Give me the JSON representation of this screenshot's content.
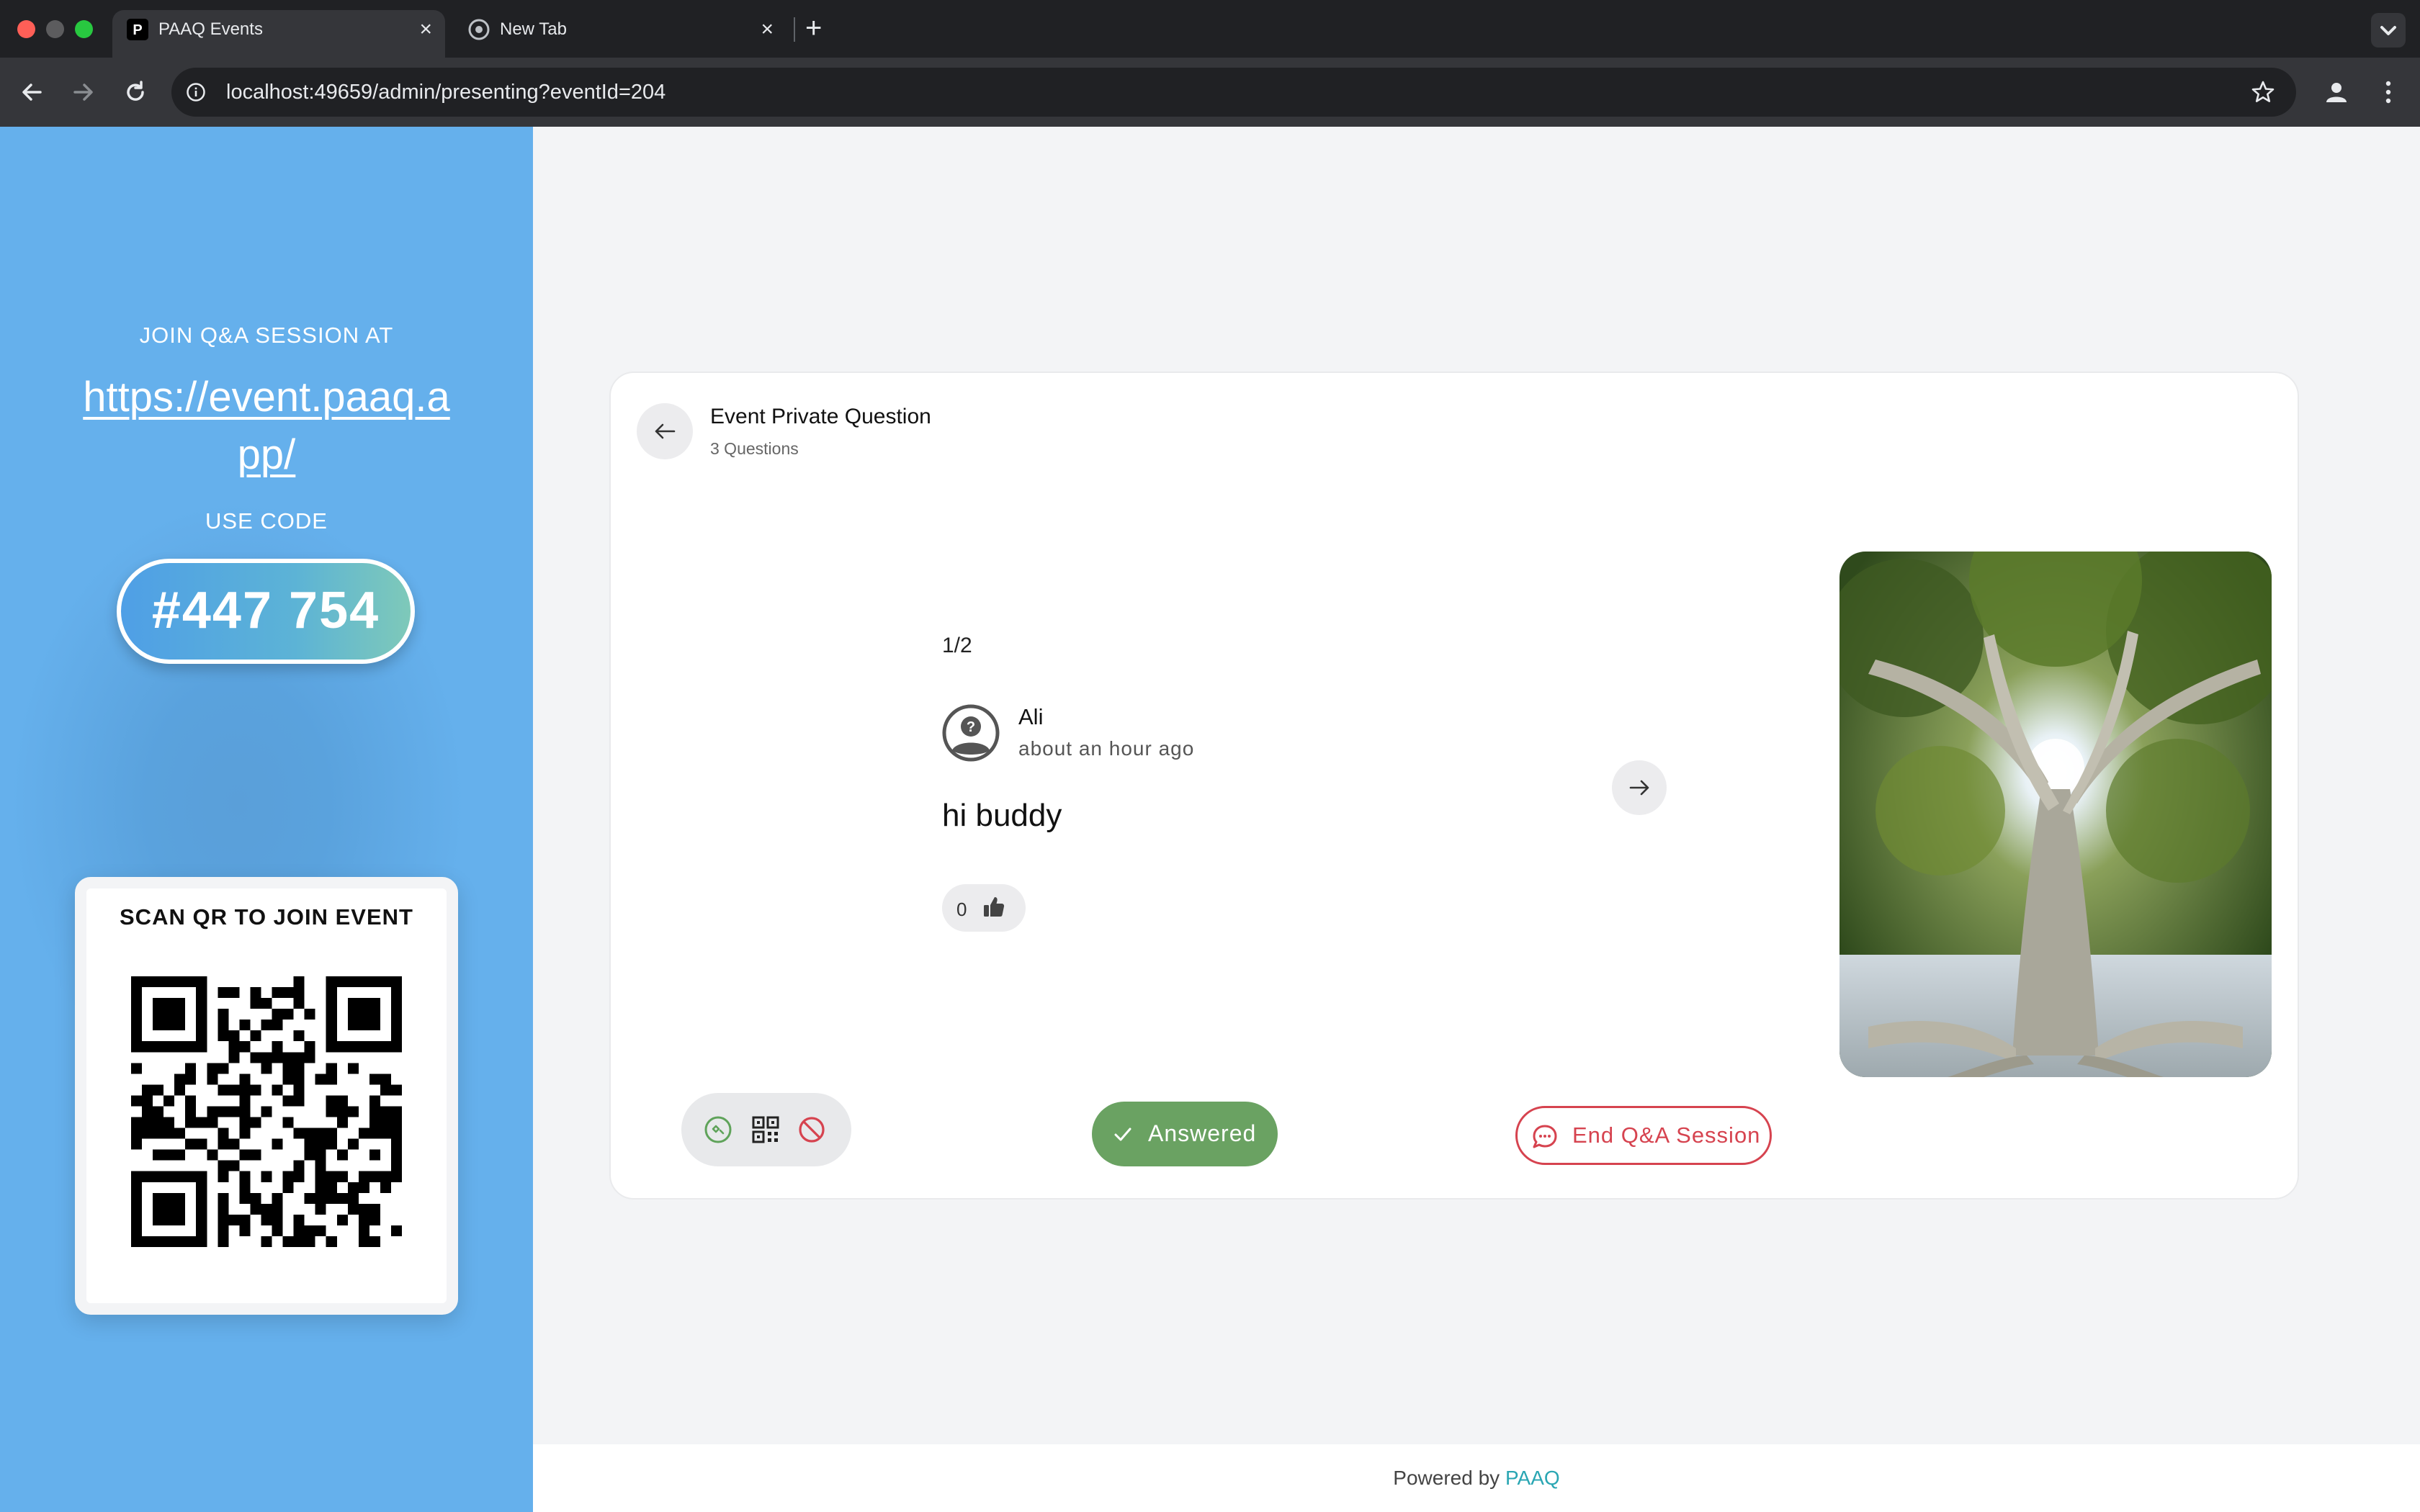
{
  "browser": {
    "tabs": [
      {
        "title": "PAAQ Events",
        "active": true
      },
      {
        "title": "New Tab",
        "active": false
      }
    ],
    "url": "localhost:49659/admin/presenting?eventId=204"
  },
  "sidebar": {
    "join_text": "JOIN Q&A SESSION AT",
    "join_url": "https://event.paaq.app/",
    "use_code_label": "USE CODE",
    "code": "#447 754",
    "qr_title": "SCAN QR TO JOIN EVENT"
  },
  "card": {
    "title": "Event Private Question",
    "subtitle": "3 Questions",
    "pager": "1/2",
    "author": "Ali",
    "time_ago": "about an hour ago",
    "question": "hi buddy",
    "likes": "0",
    "answered_label": "Answered",
    "end_session_label": "End Q&A Session"
  },
  "footer": {
    "powered_by": "Powered by",
    "brand": "PAAQ"
  },
  "colors": {
    "answered": "#6aa262",
    "end_session": "#d6434f",
    "brand_link": "#2aa6b3",
    "sidebar_blue": "#65b0ec"
  }
}
